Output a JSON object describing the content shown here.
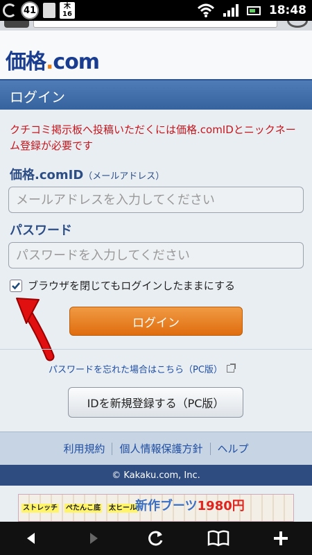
{
  "status_bar": {
    "notification_count": "41",
    "calendar_weekday": "木",
    "calendar_day": "16",
    "time": "18:48"
  },
  "header": {
    "logo_part1": "価格",
    "logo_part2": ".",
    "logo_part3": "com"
  },
  "login": {
    "title": "ログイン",
    "notice": "クチコミ掲示板へ投稿いただくには価格.comIDとニックネーム登録が必要です",
    "id_label": "価格.comID",
    "id_label_note": "（メールアドレス）",
    "email_placeholder": "メールアドレスを入力してください",
    "password_label": "パスワード",
    "password_placeholder": "パスワードを入力してください",
    "remember_label": "ブラウザを閉じてもログインしたままにする",
    "remember_checked": true,
    "login_button": "ログイン",
    "forgot_link": "パスワードを忘れた場合はこちら（PC版）",
    "register_button": "IDを新規登録する（PC版）"
  },
  "footer": {
    "links": [
      "利用規約",
      "個人情報保護方針",
      "ヘルプ"
    ],
    "copyright": "© Kakaku.com, Inc."
  },
  "banner": {
    "headline_a": "新作ブーツ",
    "headline_b": "1980円",
    "tags": [
      "ストレッチ",
      "ぺたんこ底",
      "太ヒール"
    ]
  },
  "navbar": {
    "icons": [
      "back-icon",
      "forward-icon",
      "reload-icon",
      "bookmarks-icon",
      "new-tab-icon"
    ]
  },
  "colors": {
    "brand_blue": "#1a3d8f",
    "brand_orange": "#f07d10",
    "title_bar": "#3f6ca8",
    "notice_red": "#c4161c",
    "login_orange": "#e57a1c"
  }
}
